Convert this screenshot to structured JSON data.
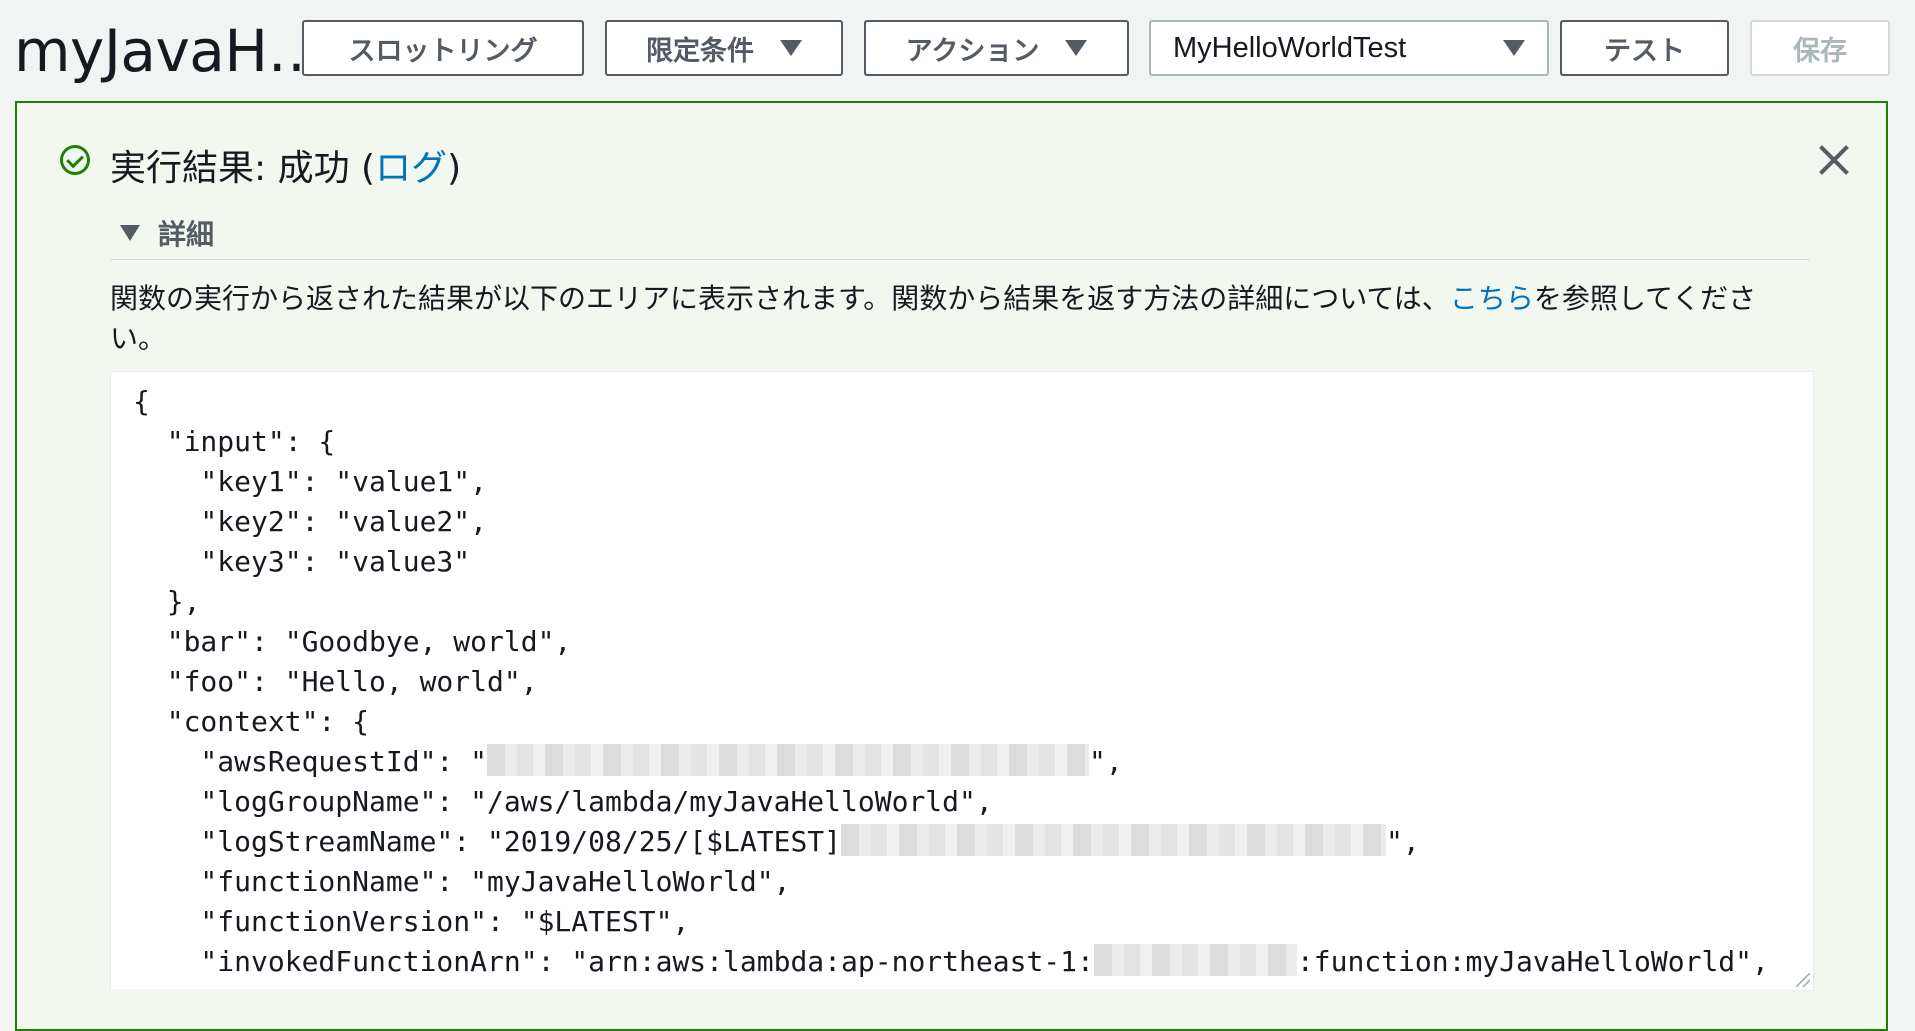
{
  "header": {
    "function_title": "myJavaH…",
    "throttle_label": "スロットリング",
    "qualifiers_label": "限定条件",
    "actions_label": "アクション",
    "test_event_selected": "MyHelloWorldTest",
    "test_label": "テスト",
    "save_label": "保存"
  },
  "result": {
    "status_prefix": "実行結果: 成功 (",
    "log_link": "ログ",
    "status_suffix": ")",
    "details_label": "詳細",
    "description_before": "関数の実行から返された結果が以下のエリアに表示されます。関数から結果を返す方法の詳細については、",
    "description_link": "こちら",
    "description_after": "を参照してください。",
    "output": {
      "l1": "{",
      "l2": "  \"input\": {",
      "l3": "    \"key1\": \"value1\",",
      "l4": "    \"key2\": \"value2\",",
      "l5": "    \"key3\": \"value3\"",
      "l6": "  },",
      "l7": "  \"bar\": \"Goodbye, world\",",
      "l8": "  \"foo\": \"Hello, world\",",
      "l9": "  \"context\": {",
      "l10a": "    \"awsRequestId\": \"",
      "l10b": "\",",
      "l11": "    \"logGroupName\": \"/aws/lambda/myJavaHelloWorld\",",
      "l12a": "    \"logStreamName\": \"2019/08/25/[$LATEST]",
      "l12b": "\",",
      "l13": "    \"functionName\": \"myJavaHelloWorld\",",
      "l14": "    \"functionVersion\": \"$LATEST\",",
      "l15a": "    \"invokedFunctionArn\": \"arn:aws:lambda:ap-northeast-1:",
      "l15b": ":function:myJavaHelloWorld\","
    }
  },
  "colors": {
    "success_border": "#1d8102",
    "success_bg": "#f2f8f0",
    "link": "#0073bb"
  },
  "icons": {
    "status": "check-circle-icon",
    "close": "close-icon",
    "details_toggle": "caret-down-icon",
    "dropdown": "caret-down-icon"
  }
}
